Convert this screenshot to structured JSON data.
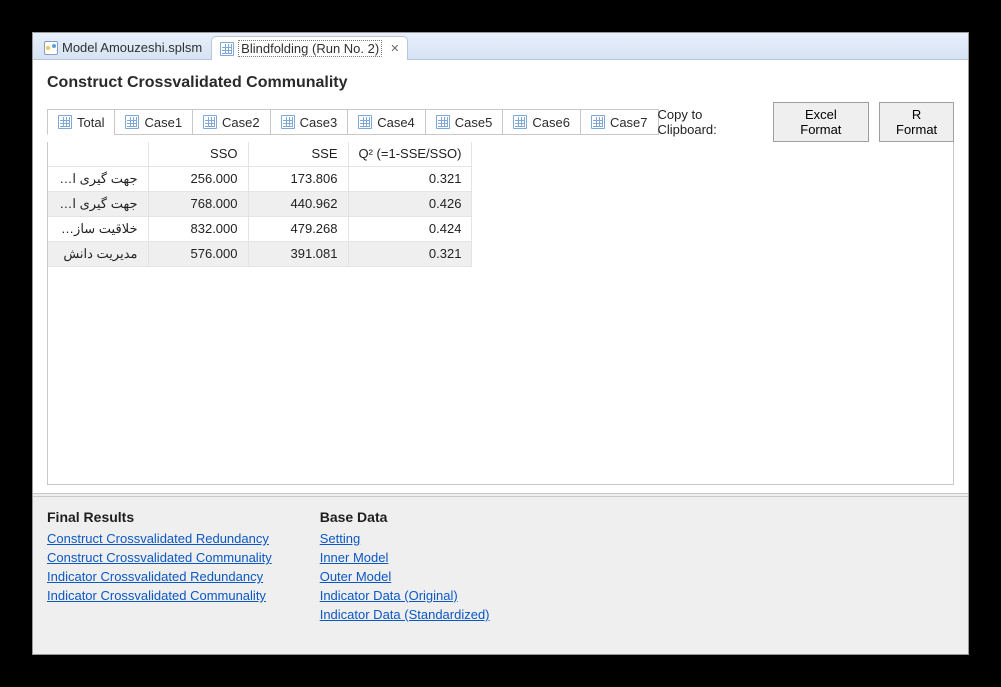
{
  "tabs": {
    "model": "Model Amouzeshi.splsm",
    "run": "Blindfolding (Run No. 2)"
  },
  "section_title": "Construct Crossvalidated Communality",
  "subtabs": [
    "Total",
    "Case1",
    "Case2",
    "Case3",
    "Case4",
    "Case5",
    "Case6",
    "Case7"
  ],
  "copy_label": "Copy to Clipboard:",
  "buttons": {
    "excel": "Excel Format",
    "r": "R Format"
  },
  "table": {
    "headers": [
      "SSO",
      "SSE",
      "Q² (=1-SSE/SSO)"
    ],
    "rows": [
      {
        "name": "جهت گیری استرا...",
        "sso": "256.000",
        "sse": "173.806",
        "q2": "0.321"
      },
      {
        "name": "جهت گیری استرا...",
        "sso": "768.000",
        "sse": "440.962",
        "q2": "0.426"
      },
      {
        "name": "خلاقیت سازمانی",
        "sso": "832.000",
        "sse": "479.268",
        "q2": "0.424"
      },
      {
        "name": "مدیریت دانش",
        "sso": "576.000",
        "sse": "391.081",
        "q2": "0.321"
      }
    ]
  },
  "links": {
    "final_heading": "Final Results",
    "final": [
      "Construct Crossvalidated Redundancy",
      "Construct Crossvalidated Communality",
      "Indicator Crossvalidated Redundancy",
      "Indicator Crossvalidated Communality"
    ],
    "base_heading": "Base Data",
    "base": [
      "Setting",
      "Inner Model",
      "Outer Model",
      "Indicator Data (Original)",
      "Indicator Data (Standardized)"
    ]
  }
}
